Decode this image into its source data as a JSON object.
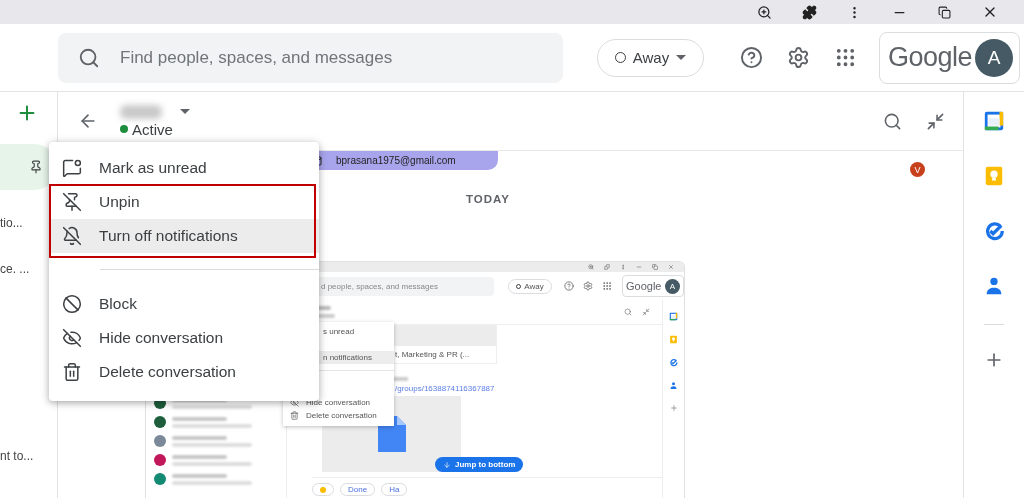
{
  "search": {
    "placeholder": "Find people, spaces, and messages"
  },
  "status": {
    "label": "Away"
  },
  "account": {
    "logo": "Google",
    "avatar": "A"
  },
  "nav": {
    "items": [
      {
        "selected": true
      }
    ],
    "snippets": [
      "tio...",
      "ce. ...",
      "nt to..."
    ]
  },
  "chat": {
    "presence": "Active",
    "online": true,
    "email": "bprasana1975@gmail.com",
    "sender_avatar": "V",
    "day": "TODAY"
  },
  "menu": {
    "groups": [
      [
        {
          "kind": "unread",
          "label": "Mark as unread",
          "selected": false
        },
        {
          "kind": "unpin",
          "label": "Unpin",
          "selected": false
        },
        {
          "kind": "mute",
          "label": "Turn off notifications",
          "selected": true
        }
      ],
      [
        {
          "kind": "block",
          "label": "Block",
          "selected": false
        },
        {
          "kind": "hide",
          "label": "Hide conversation",
          "selected": false
        },
        {
          "kind": "delete",
          "label": "Delete conversation",
          "selected": false
        }
      ]
    ]
  },
  "embedded": {
    "search_placeholder": "d people, spaces, and messages",
    "status": "Away",
    "logo": "Google",
    "avatar": "A",
    "menu": [
      [
        {
          "label": "s unread",
          "selected": false
        }
      ],
      [
        {
          "label": "n notifications",
          "selected": true
        }
      ],
      [
        {
          "kind": "hide",
          "label": "Hide conversation",
          "selected": false
        },
        {
          "kind": "delete",
          "label": "Delete conversation",
          "selected": false
        }
      ]
    ],
    "card": "t, Marketing & PR (...",
    "link": "/groups/1638874116367887",
    "jump": "Jump to bottom",
    "chips": [
      "Done",
      "Ha"
    ],
    "chats": [
      {
        "color": "#1e5e3c"
      },
      {
        "color": "#1e5e3c"
      },
      {
        "color": "#7b8a99"
      },
      {
        "color": "#c2185b"
      },
      {
        "color": "#138a72"
      }
    ]
  }
}
